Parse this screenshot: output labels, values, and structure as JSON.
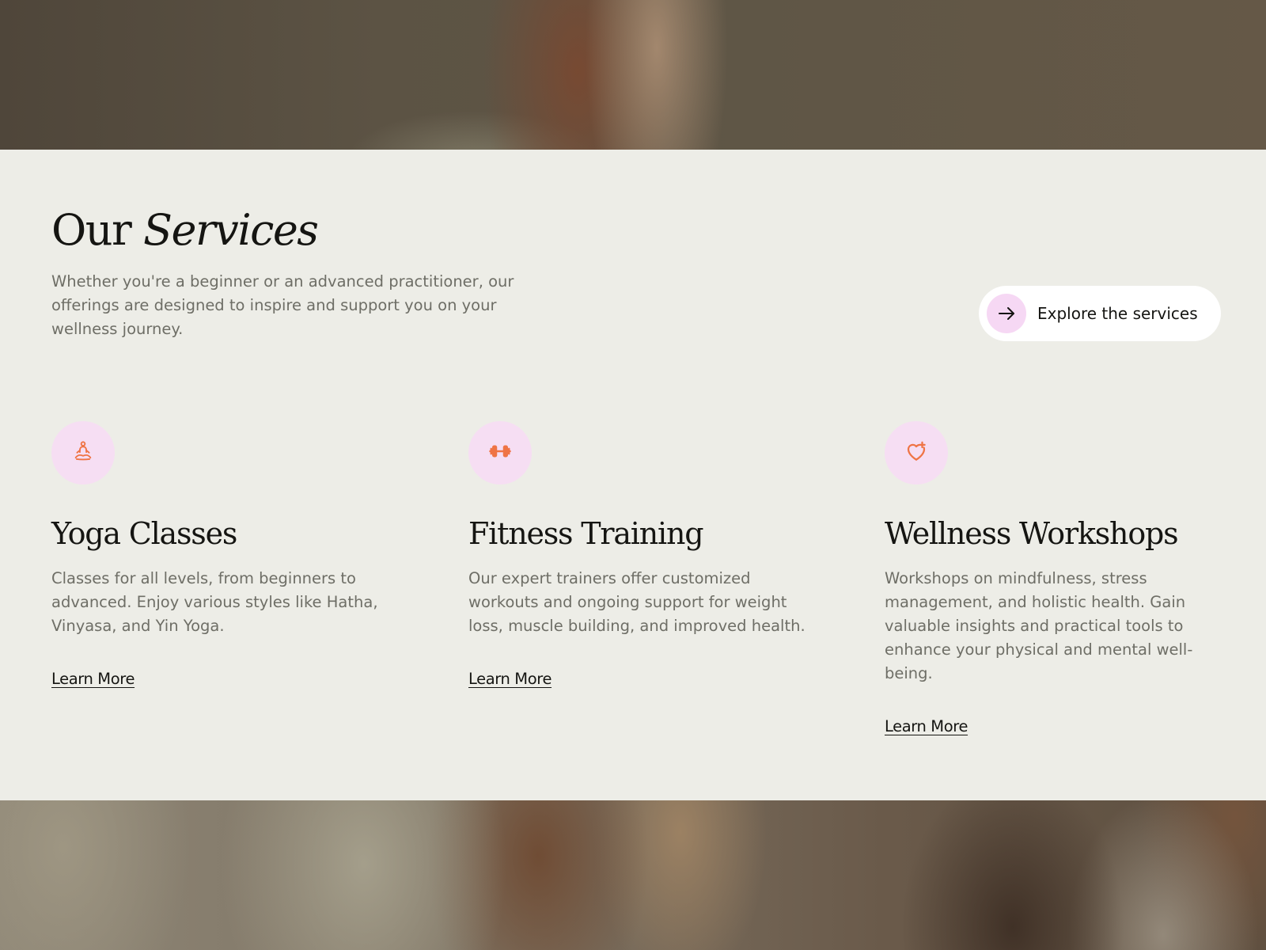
{
  "section": {
    "heading_regular": "Our",
    "heading_italic": "Services",
    "intro": "Whether you're a beginner or an advanced practitioner, our offerings are designed to inspire and support you on your wellness journey.",
    "explore_button": {
      "label": "Explore the services",
      "icon": "arrow-right-icon"
    }
  },
  "cards": [
    {
      "icon": "meditation-icon",
      "title": "Yoga Classes",
      "description": "Classes for all levels, from beginners to advanced. Enjoy various styles like Hatha, Vinyasa, and Yin Yoga.",
      "link": "Learn More"
    },
    {
      "icon": "dumbbell-icon",
      "title": "Fitness Training",
      "description": "Our expert trainers offer customized workouts and ongoing support for weight loss, muscle building, and improved health.",
      "link": "Learn More"
    },
    {
      "icon": "heart-plus-icon",
      "title": "Wellness Workshops",
      "description": "Workshops on mindfulness, stress management, and holistic health. Gain valuable insights and practical tools to enhance your physical and mental well-being.",
      "link": "Learn More"
    }
  ],
  "colors": {
    "background": "#edede7",
    "icon_accent": "#ef7445",
    "icon_bubble": "#f6def3",
    "button_bg": "#ffffff"
  }
}
